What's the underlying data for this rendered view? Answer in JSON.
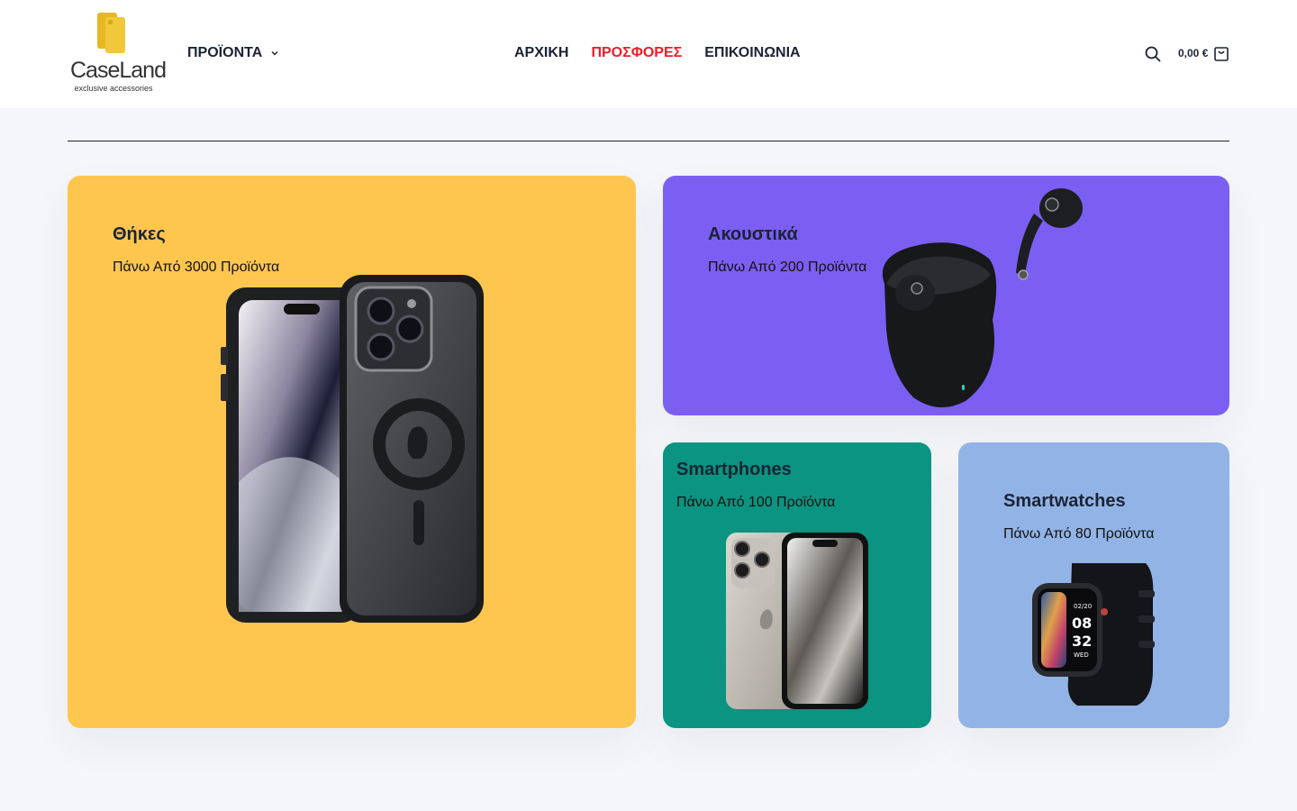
{
  "brand": {
    "name": "CaseLand",
    "tagline": "exclusive accessories",
    "logo_color": "#f1c73b"
  },
  "nav": {
    "products_label": "ΠΡΟΪΟΝΤΑ",
    "home_label": "ΑΡΧΙΚΗ",
    "offers_label": "ΠΡΟΣΦΟΡΕΣ",
    "contact_label": "ΕΠΙΚΟΙΝΩΝΙΑ",
    "offers_color": "#ee1c25"
  },
  "header_tools": {
    "cart_total": "0,00 €",
    "search_icon": "search-icon",
    "cart_icon": "shopping-bag-icon"
  },
  "categories": [
    {
      "title": "Θήκες",
      "subtitle": "Πάνω Από 3000 Προϊόντα",
      "color": "#fec64f",
      "image": "iphone-magsafe-case"
    },
    {
      "title": "Ακουστικά",
      "subtitle": "Πάνω Από 200 Προϊόντα",
      "color": "#7b5ff3",
      "image": "wireless-earbuds"
    },
    {
      "title": "Smartphones",
      "subtitle": "Πάνω Από 100 Προϊόντα",
      "color": "#0a9481",
      "image": "smartphone"
    },
    {
      "title": "Smartwatches",
      "subtitle": "Πάνω Από 80 Προϊόντα",
      "color": "#92b3e5",
      "image": "smartwatch"
    }
  ],
  "watch_face": {
    "date": "02/20",
    "hour": "08",
    "minute": "32",
    "day": "WED"
  }
}
